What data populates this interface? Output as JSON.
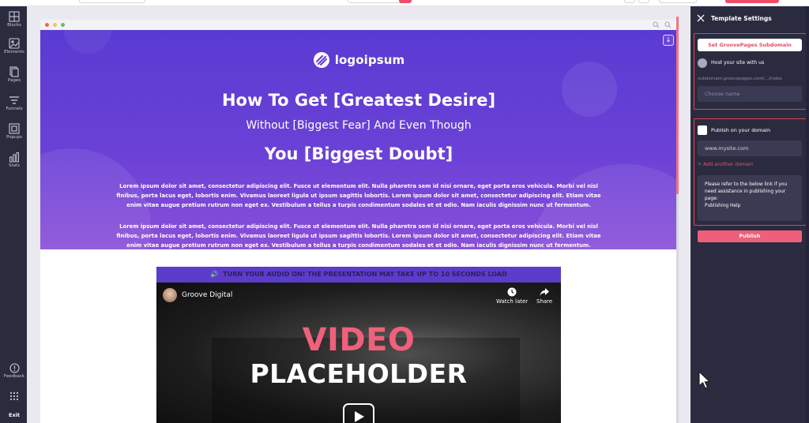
{
  "sidebar": {
    "items": [
      {
        "label": "Blocks",
        "icon": "blocks-icon"
      },
      {
        "label": "Elements",
        "icon": "elements-icon"
      },
      {
        "label": "Pages",
        "icon": "pages-icon"
      },
      {
        "label": "Funnels",
        "icon": "funnels-icon"
      },
      {
        "label": "Popups",
        "icon": "popups-icon"
      },
      {
        "label": "Stats",
        "icon": "stats-icon"
      }
    ],
    "feedback_label": "Feedback",
    "exit_label": "Exit"
  },
  "hero": {
    "logo_text": "logoipsum",
    "headline_1": "How To Get [Greatest Desire]",
    "subheadline": "Without [Biggest Fear] And Even Though",
    "headline_2": "You [Biggest Doubt]",
    "paragraph_1": "Lorem ipsum dolor sit amet, consectetur adipiscing elit. Fusce ut elementum elit. Nulla pharetra sem id nisi ornare, eget porta eros vehicula. Morbi vel nisl finibus, porta lacus eget, lobortis enim. Vivamus laoreet ligula ut ipsum sagittis lobortis. Lorem ipsum dolor sit amet, consectetur adipiscing elit. Etiam vitae enim vitae augue pretium rutrum non eget ex. Vestibulum a tellus a turpis condimentum sodales et et odio. Nam iaculis dignissim nunc ut fermentum.",
    "paragraph_2": "Lorem ipsum dolor sit amet, consectetur adipiscing elit. Fusce ut elementum elit. Nulla pharetra sem id nisi ornare, eget porta eros vehicula. Morbi vel nisl finibus, porta lacus eget, lobortis enim. Vivamus laoreet ligula ut ipsum sagittis lobortis. Lorem ipsum dolor sit amet, consectetur adipiscing elit. Etiam vitae enim vitae augue pretium rutrum non eget ex. Vestibulum a tellus a turpis condimentum sodales et et odio. Nam iaculis dignissim nunc ut fermentum."
  },
  "video": {
    "audio_banner": "TURN YOUR AUDIO ON! THE PRESENTATION MAY TAKE UP TO 10 SECONDS LOAD",
    "channel_name": "Groove Digital",
    "watch_later_label": "Watch later",
    "share_label": "Share",
    "title_line_1": "VIDEO",
    "title_line_2": "PLACEHOLDER"
  },
  "panel": {
    "title": "Template Settings",
    "subdomain_button": "Set GroovePages Subdomain",
    "host_label": "Host your site with us",
    "subdomain_url": "subdomain.groovepages.com/.../index",
    "choose_name_placeholder": "Choose name",
    "publish_domain_label": "Publish on your domain",
    "domain_input_value": "www.mysite.com",
    "add_domain_link": "+ Add another domain",
    "help_text": "Please refer to the below link if you need assistance in publishing your page:",
    "help_link": "Publishing Help",
    "publish_button": "Publish"
  },
  "colors": {
    "sidebar_bg": "#2b2b40",
    "hero_top": "#5a3bd2",
    "hero_bottom": "#8a4fd8",
    "accent_red": "#ef4c67",
    "video_title_pink": "#f0607a"
  }
}
